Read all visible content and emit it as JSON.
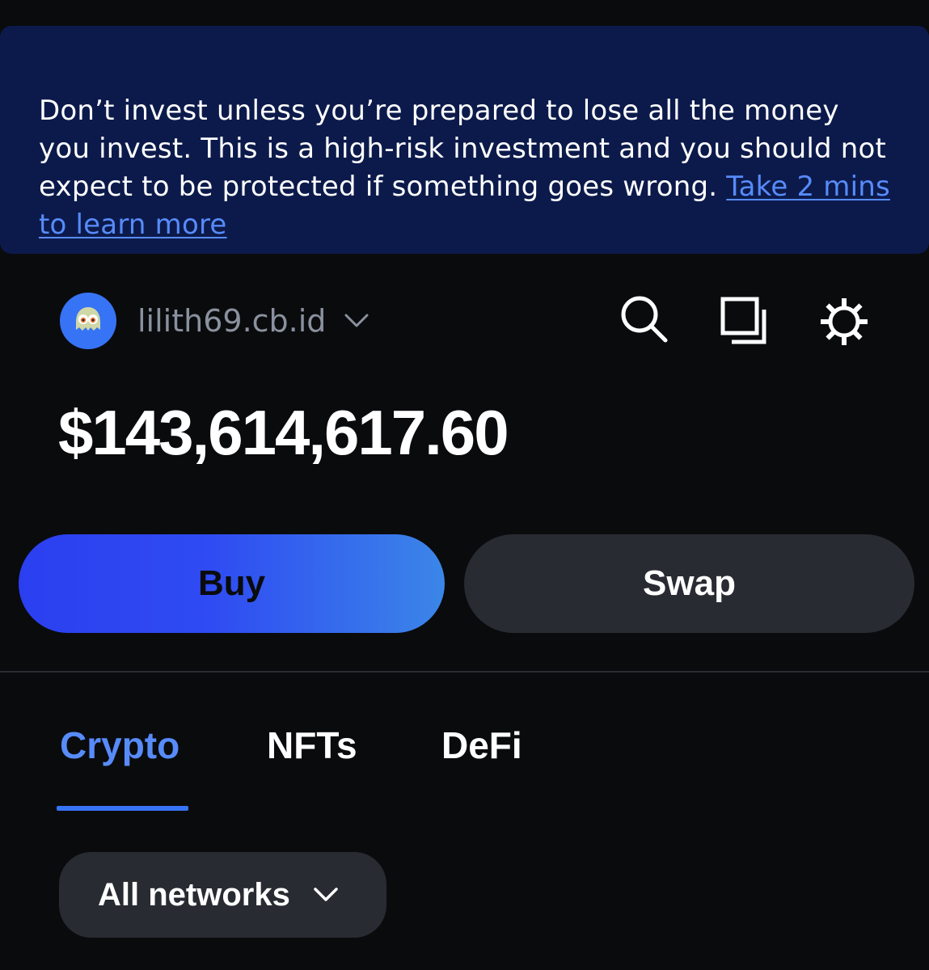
{
  "risk_banner": {
    "message": "Don’t invest unless you’re prepared to lose all the money you invest. This is a high-risk investment and you should not expect to be protected if something goes wrong. ",
    "link_label": "Take 2 mins to learn more"
  },
  "account": {
    "name": "lilith69.cb.id",
    "avatar_icon": "ghost-avatar-icon"
  },
  "header_icons": [
    "search-icon",
    "copy-icon",
    "settings-gear-icon"
  ],
  "balance": "$143,614,617.60",
  "actions": {
    "buy_label": "Buy",
    "swap_label": "Swap"
  },
  "tabs": [
    {
      "label": "Crypto",
      "active": true
    },
    {
      "label": "NFTs",
      "active": false
    },
    {
      "label": "DeFi",
      "active": false
    }
  ],
  "network_filter": {
    "selected": "All networks"
  },
  "colors": {
    "background": "#0a0b0d",
    "banner": "#0c1a4b",
    "accent": "#3773f5",
    "link": "#578bfa",
    "surface": "#282b31"
  }
}
